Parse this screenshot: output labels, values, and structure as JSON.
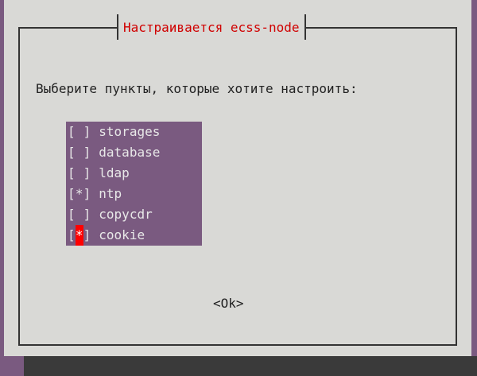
{
  "dialog": {
    "title": "Настраивается ecss-node",
    "prompt": "Выберите пункты, которые хотите настроить:",
    "ok_label": "<Ok>"
  },
  "items": [
    {
      "label": "storages",
      "mark": " ",
      "checked": false
    },
    {
      "label": "database",
      "mark": " ",
      "checked": false
    },
    {
      "label": "ldap",
      "mark": " ",
      "checked": false
    },
    {
      "label": "ntp",
      "mark": "*",
      "checked": true
    },
    {
      "label": "copycdr",
      "mark": " ",
      "checked": false
    },
    {
      "label": "cookie",
      "mark": "*",
      "checked": true,
      "focused": true
    }
  ],
  "colors": {
    "background": "#7a5a80",
    "dialog": "#d9d9d6",
    "title": "#d00000",
    "cursor": "#ff0000"
  }
}
